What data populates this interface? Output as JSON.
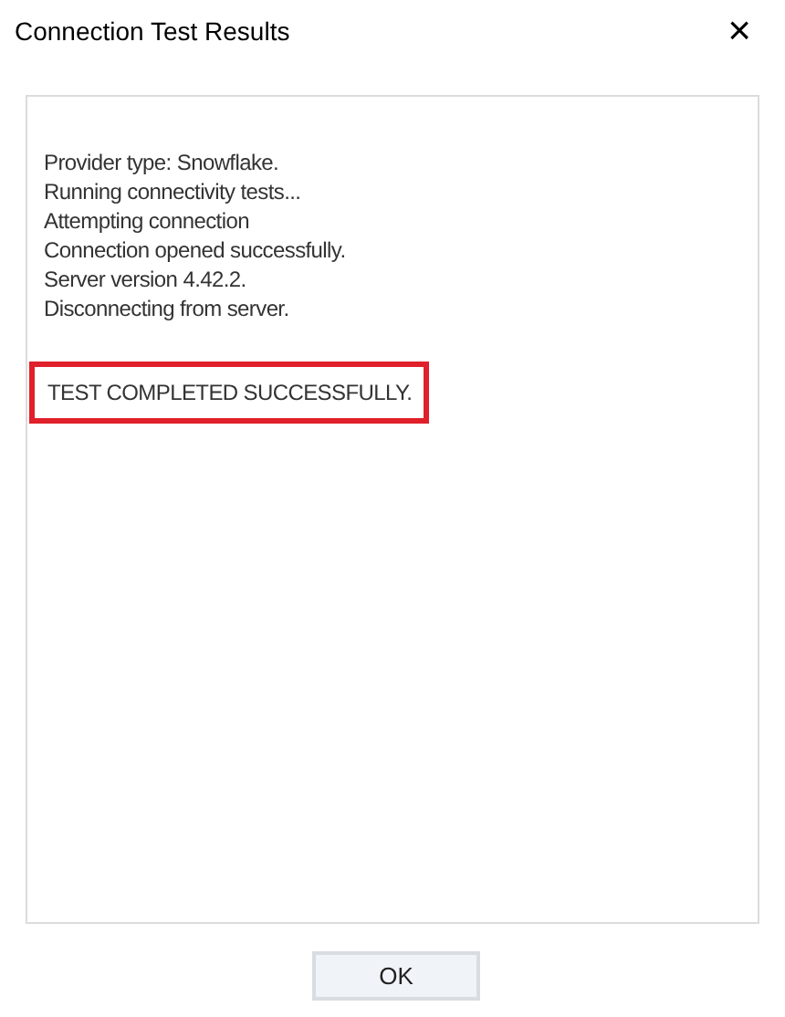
{
  "window": {
    "title": "Connection Test Results",
    "close": "×"
  },
  "log_lines": [
    "Provider type: Snowflake.",
    "Running connectivity tests...",
    "Attempting connection",
    "Connection opened successfully.",
    "Server version 4.42.2.",
    "Disconnecting from server."
  ],
  "result": {
    "text": "TEST COMPLETED SUCCESSFULLY.",
    "highlighted": true
  },
  "buttons": [
    "OK"
  ]
}
